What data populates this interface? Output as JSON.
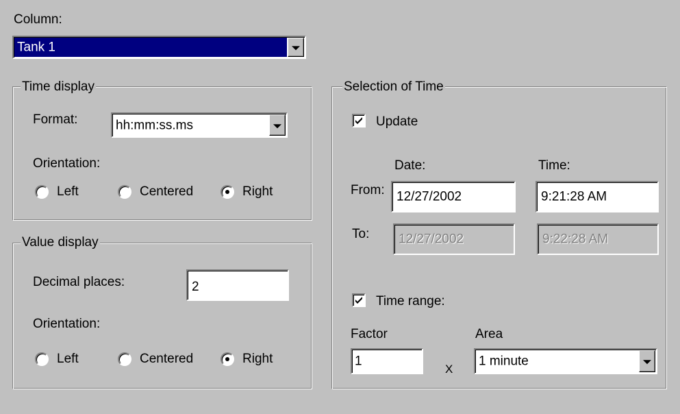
{
  "column": {
    "label": "Column:",
    "selected": "Tank 1"
  },
  "time_display": {
    "title": "Time display",
    "format_label": "Format:",
    "format_value": "hh:mm:ss.ms",
    "orientation_label": "Orientation:",
    "orientation_options": [
      "Left",
      "Centered",
      "Right"
    ],
    "orientation_selected": "Right"
  },
  "value_display": {
    "title": "Value display",
    "decimal_label": "Decimal places:",
    "decimal_value": "2",
    "orientation_label": "Orientation:",
    "orientation_options": [
      "Left",
      "Centered",
      "Right"
    ],
    "orientation_selected": "Right"
  },
  "selection_of_time": {
    "title": "Selection of Time",
    "update_label": "Update",
    "update_checked": true,
    "date_header": "Date:",
    "time_header": "Time:",
    "from_label": "From:",
    "from_date": "12/27/2002",
    "from_time": "9:21:28 AM",
    "to_label": "To:",
    "to_date": "12/27/2002",
    "to_time": "9:22:28 AM",
    "time_range_label": "Time range:",
    "time_range_checked": true,
    "factor_label": "Factor",
    "factor_value": "1",
    "multiply_symbol": "X",
    "area_label": "Area",
    "area_value": "1 minute"
  }
}
